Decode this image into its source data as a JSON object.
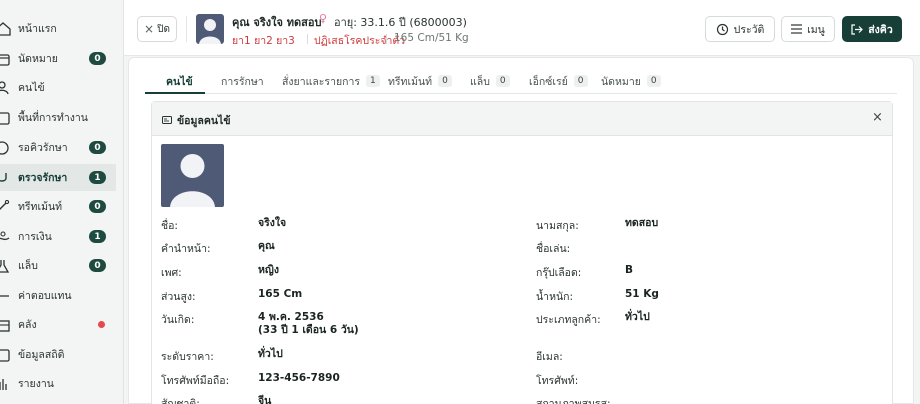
{
  "sidebar": {
    "items": [
      {
        "label": "หน้าแรก",
        "icon": "home-icon",
        "badge": null
      },
      {
        "label": "นัดหมาย",
        "icon": "calendar-icon",
        "badge": "0"
      },
      {
        "label": "คนไข้",
        "icon": "user-icon",
        "badge": null
      },
      {
        "label": "พื้นที่การทำงาน",
        "icon": "workspace-icon",
        "badge": null
      },
      {
        "label": "รอคิวรักษา",
        "icon": "queue-icon",
        "badge": "0"
      },
      {
        "label": "ตรวจรักษา",
        "icon": "stethoscope-icon",
        "badge": "1"
      },
      {
        "label": "ทรีทเม้นท์",
        "icon": "treatment-icon",
        "badge": "0"
      },
      {
        "label": "การเงิน",
        "icon": "money-icon",
        "badge": "1"
      },
      {
        "label": "แล็บ",
        "icon": "lab-icon",
        "badge": "0"
      },
      {
        "label": "ค่าตอบแทน",
        "icon": "compensation-icon",
        "badge": null
      },
      {
        "label": "คลัง",
        "icon": "warehouse-icon",
        "badge": null
      },
      {
        "label": "ข้อมูลสถิติ",
        "icon": "statistics-icon",
        "badge": null
      },
      {
        "label": "รายงาน",
        "icon": "report-icon",
        "badge": null
      }
    ]
  },
  "header": {
    "close_label": "ปิด",
    "patient_name": "คุณ จริงใจ ทดสอบ",
    "age_text": "อายุ: 33.1.6 ปี (6800003)",
    "meds": "ยา1 ยา2 ยา3",
    "allergy": "ปฏิเสธโรคประจำตัว",
    "size": "165 Cm/51 Kg",
    "history_label": "ประวัติ",
    "menu_label": "เมนู",
    "send_label": "ส่งคิว"
  },
  "tabs": [
    {
      "label": "คนไข้",
      "count": null
    },
    {
      "label": "การรักษา",
      "count": null
    },
    {
      "label": "สั่งยาและรายการ",
      "count": "1"
    },
    {
      "label": "ทรีทเม้นท์",
      "count": "0"
    },
    {
      "label": "แล็บ",
      "count": "0"
    },
    {
      "label": "เอ็กซ์เรย์",
      "count": "0"
    },
    {
      "label": "นัดหมาย",
      "count": "0"
    }
  ],
  "card": {
    "title": "ข้อมูลคนไข้"
  },
  "fields": {
    "first_name": {
      "label": "ชื่อ:",
      "value": "จริงใจ"
    },
    "last_name": {
      "label": "นามสกุล:",
      "value": "ทดสอบ"
    },
    "prefix": {
      "label": "คำนำหน้า:",
      "value": "คุณ"
    },
    "nickname": {
      "label": "ชื่อเล่น:",
      "value": ""
    },
    "gender": {
      "label": "เพศ:",
      "value": "หญิง"
    },
    "blood_group": {
      "label": "กรุ๊ปเลือด:",
      "value": "B"
    },
    "height": {
      "label": "ส่วนสูง:",
      "value": "165 Cm"
    },
    "weight": {
      "label": "น้ำหนัก:",
      "value": "51 Kg"
    },
    "birthdate": {
      "label": "วันเกิด:",
      "value": "4 พ.ค. 2536",
      "value2": "(33 ปี 1 เดือน 6 วัน)"
    },
    "customer_type": {
      "label": "ประเภทลูกค้า:",
      "value": "ทั่วไป"
    },
    "price_level": {
      "label": "ระดับราคา:",
      "value": "ทั่วไป"
    },
    "email": {
      "label": "อีเมล:",
      "value": ""
    },
    "mobile": {
      "label": "โทรศัพท์มือถือ:",
      "value": "123-456-7890"
    },
    "phone": {
      "label": "โทรศัพท์:",
      "value": ""
    },
    "nationality": {
      "label": "สัญชาติ:",
      "value": "จีน"
    },
    "marital_status": {
      "label": "สถานภาพสมรส:",
      "value": ""
    }
  }
}
